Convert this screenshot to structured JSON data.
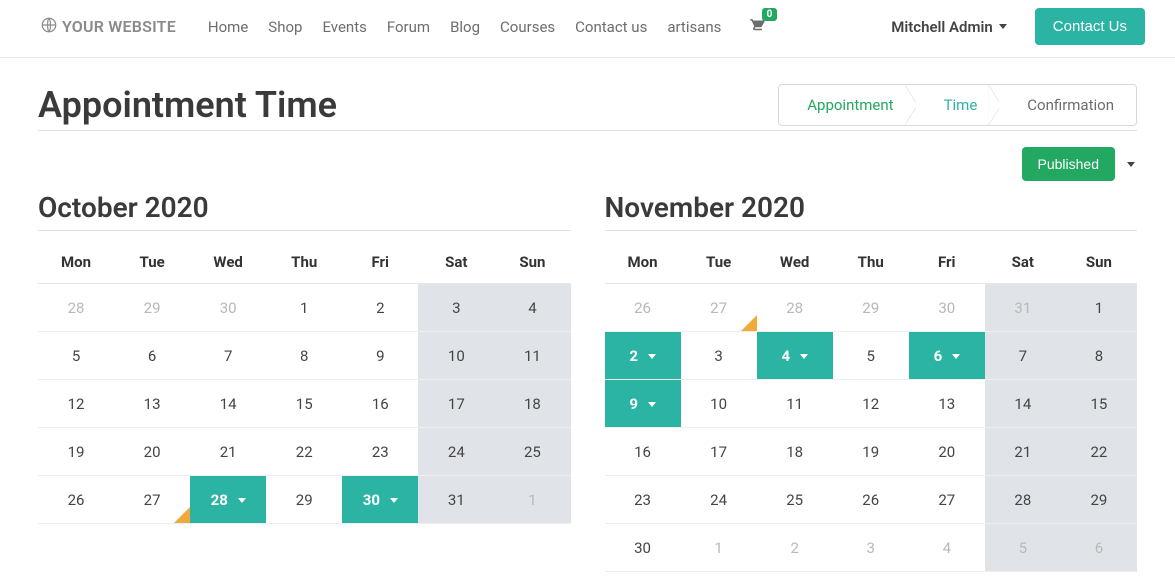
{
  "logo_text": "YOUR WEBSITE",
  "nav": [
    "Home",
    "Shop",
    "Events",
    "Forum",
    "Blog",
    "Courses",
    "Contact us",
    "artisans"
  ],
  "cart_count": "0",
  "user_name": "Mitchell Admin",
  "contact_us": "Contact Us",
  "page_title": "Appointment Time",
  "steps": {
    "appointment": "Appointment",
    "time": "Time",
    "confirmation": "Confirmation"
  },
  "published_label": "Published",
  "weekdays": [
    "Mon",
    "Tue",
    "Wed",
    "Thu",
    "Fri",
    "Sat",
    "Sun"
  ],
  "months": [
    {
      "title": "October 2020",
      "weeks": [
        [
          {
            "d": "28",
            "other": true
          },
          {
            "d": "29",
            "other": true
          },
          {
            "d": "30",
            "other": true
          },
          {
            "d": "1"
          },
          {
            "d": "2"
          },
          {
            "d": "3",
            "weekend": true
          },
          {
            "d": "4",
            "weekend": true
          }
        ],
        [
          {
            "d": "5"
          },
          {
            "d": "6"
          },
          {
            "d": "7"
          },
          {
            "d": "8"
          },
          {
            "d": "9"
          },
          {
            "d": "10",
            "weekend": true
          },
          {
            "d": "11",
            "weekend": true
          }
        ],
        [
          {
            "d": "12"
          },
          {
            "d": "13"
          },
          {
            "d": "14"
          },
          {
            "d": "15"
          },
          {
            "d": "16"
          },
          {
            "d": "17",
            "weekend": true
          },
          {
            "d": "18",
            "weekend": true
          }
        ],
        [
          {
            "d": "19"
          },
          {
            "d": "20"
          },
          {
            "d": "21"
          },
          {
            "d": "22"
          },
          {
            "d": "23"
          },
          {
            "d": "24",
            "weekend": true
          },
          {
            "d": "25",
            "weekend": true
          }
        ],
        [
          {
            "d": "26"
          },
          {
            "d": "27",
            "marker": true
          },
          {
            "d": "28",
            "avail": true
          },
          {
            "d": "29"
          },
          {
            "d": "30",
            "avail": true
          },
          {
            "d": "31",
            "weekend": true
          },
          {
            "d": "1",
            "weekend": true,
            "other": true
          }
        ]
      ]
    },
    {
      "title": "November 2020",
      "weeks": [
        [
          {
            "d": "26",
            "other": true
          },
          {
            "d": "27",
            "other": true,
            "marker": true
          },
          {
            "d": "28",
            "other": true
          },
          {
            "d": "29",
            "other": true
          },
          {
            "d": "30",
            "other": true
          },
          {
            "d": "31",
            "weekend": true,
            "other": true
          },
          {
            "d": "1",
            "weekend": true
          }
        ],
        [
          {
            "d": "2",
            "avail": true
          },
          {
            "d": "3"
          },
          {
            "d": "4",
            "avail": true
          },
          {
            "d": "5"
          },
          {
            "d": "6",
            "avail": true
          },
          {
            "d": "7",
            "weekend": true
          },
          {
            "d": "8",
            "weekend": true
          }
        ],
        [
          {
            "d": "9",
            "avail": true
          },
          {
            "d": "10"
          },
          {
            "d": "11"
          },
          {
            "d": "12"
          },
          {
            "d": "13"
          },
          {
            "d": "14",
            "weekend": true
          },
          {
            "d": "15",
            "weekend": true
          }
        ],
        [
          {
            "d": "16"
          },
          {
            "d": "17"
          },
          {
            "d": "18"
          },
          {
            "d": "19"
          },
          {
            "d": "20"
          },
          {
            "d": "21",
            "weekend": true
          },
          {
            "d": "22",
            "weekend": true
          }
        ],
        [
          {
            "d": "23"
          },
          {
            "d": "24"
          },
          {
            "d": "25"
          },
          {
            "d": "26"
          },
          {
            "d": "27"
          },
          {
            "d": "28",
            "weekend": true
          },
          {
            "d": "29",
            "weekend": true
          }
        ],
        [
          {
            "d": "30"
          },
          {
            "d": "1",
            "other": true
          },
          {
            "d": "2",
            "other": true
          },
          {
            "d": "3",
            "other": true
          },
          {
            "d": "4",
            "other": true
          },
          {
            "d": "5",
            "weekend": true,
            "other": true
          },
          {
            "d": "6",
            "weekend": true,
            "other": true
          }
        ]
      ]
    }
  ]
}
